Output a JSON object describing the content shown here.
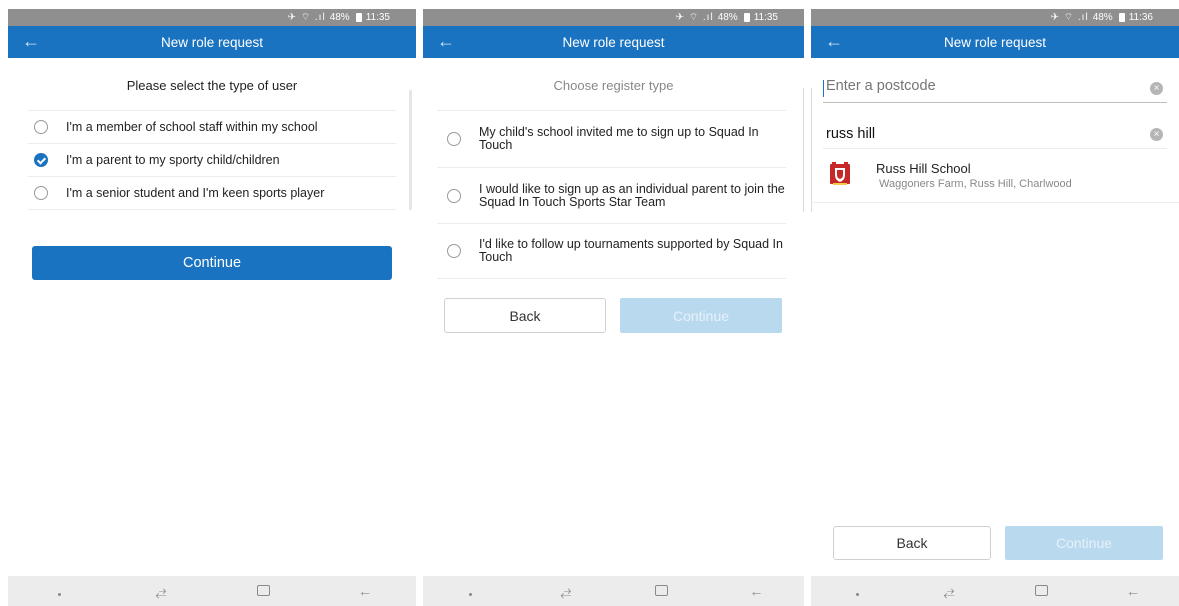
{
  "status_bar": {
    "screen1": {
      "icons": "✈ ⌔ .ıl",
      "battery": "48%",
      "time": "11:35"
    },
    "screen2": {
      "icons": "✈ ⌔ .ıl",
      "battery": "48%",
      "time": "11:35"
    },
    "screen3": {
      "icons": "✈ ⌔ .ıl",
      "battery": "48%",
      "time": "11:36"
    }
  },
  "app_bar": {
    "title": "New role request",
    "back_icon": "←"
  },
  "screen1": {
    "heading": "Please select the type of user",
    "options": [
      {
        "label": "I'm a member of school staff within my school",
        "checked": false
      },
      {
        "label": "I'm a parent to my sporty child/children",
        "checked": true
      },
      {
        "label": "I'm a senior student and I'm keen sports player",
        "checked": false
      }
    ],
    "continue_label": "Continue"
  },
  "screen2": {
    "heading": "Choose register type",
    "options": [
      {
        "label": "My child's school invited me to sign up to Squad In Touch",
        "checked": false
      },
      {
        "label": "I would like to sign up as an individual parent to join the Squad In Touch Sports Star Team",
        "checked": false
      },
      {
        "label": "I'd like to follow up tournaments supported by Squad In Touch",
        "checked": false
      }
    ],
    "back_label": "Back",
    "continue_label": "Continue"
  },
  "screen3": {
    "postcode_placeholder": "Enter a postcode",
    "search_value": "russ hill",
    "clear_icon": "×",
    "result": {
      "name": "Russ Hill School",
      "address": "Waggoners Farm, Russ Hill, Charlwood"
    },
    "back_label": "Back",
    "continue_label": "Continue"
  },
  "nav_bar": {
    "recents_icon": "⥄",
    "back_icon": "←"
  },
  "colors": {
    "primary": "#1a73c0",
    "disabled": "#b9d9ef",
    "status_bar": "#8f8f8f"
  }
}
